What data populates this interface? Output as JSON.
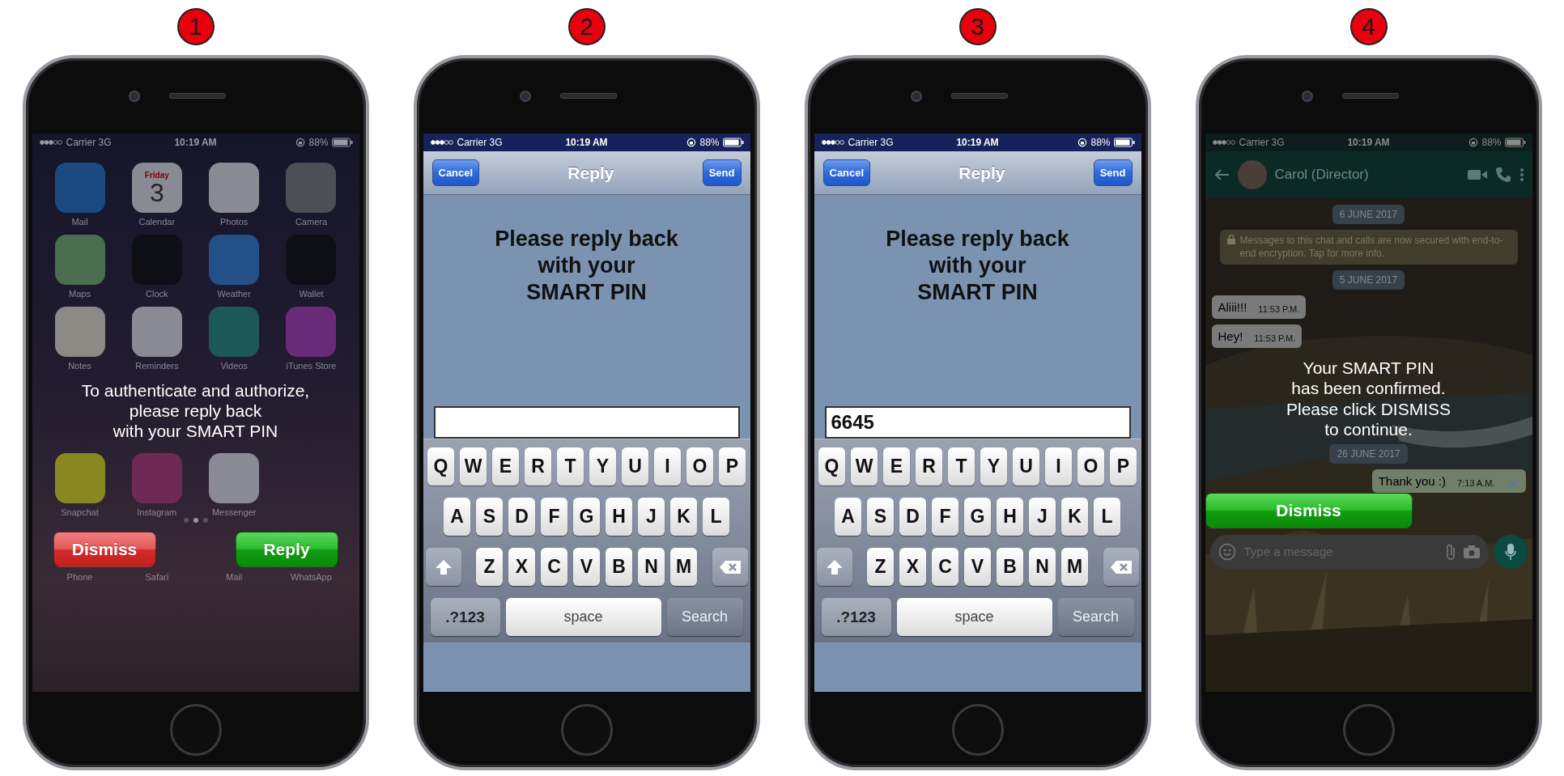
{
  "steps": [
    {
      "number": "1",
      "kind": "home_alert",
      "status_bar": {
        "carrier": "Carrier 3G",
        "time": "10:19 AM",
        "battery": "88%"
      },
      "apps": [
        {
          "label": "Mail",
          "color": "#1b4a80"
        },
        {
          "label": "Calendar",
          "color": "#8a8a94",
          "day": "Friday",
          "date": "3"
        },
        {
          "label": "Photos",
          "color": "#8a8a94"
        },
        {
          "label": "Camera",
          "color": "#4e4e56"
        },
        {
          "label": "Maps",
          "color": "#4a6e50"
        },
        {
          "label": "Clock",
          "color": "#0e0e16"
        },
        {
          "label": "Weather",
          "color": "#24508a"
        },
        {
          "label": "Wallet",
          "color": "#0e0e16"
        },
        {
          "label": "Notes",
          "color": "#8c8a84"
        },
        {
          "label": "Reminders",
          "color": "#8a8a94"
        },
        {
          "label": "Videos",
          "color": "#1d5858"
        },
        {
          "label": "iTunes Store",
          "color": "#6a2a7a"
        }
      ],
      "message": "To authenticate and authorize,\nplease reply back\nwith your SMART PIN",
      "more_apps": [
        {
          "label": "Snapchat",
          "color": "#8a8820"
        },
        {
          "label": "Instagram",
          "color": "#6e2a55"
        },
        {
          "label": "Messenger",
          "color": "#8a8a94"
        }
      ],
      "buttons": [
        {
          "label": "Dismiss",
          "kind": "danger"
        },
        {
          "label": "Reply",
          "kind": "confirm"
        }
      ],
      "dock": [
        {
          "label": "Phone"
        },
        {
          "label": "Safari"
        },
        {
          "label": "Mail"
        },
        {
          "label": "WhatsApp"
        }
      ]
    },
    {
      "number": "2",
      "kind": "reply_form",
      "status_bar": {
        "carrier": "Carrier 3G",
        "time": "10:19 AM",
        "battery": "88%"
      },
      "nav": {
        "cancel": "Cancel",
        "title": "Reply",
        "send": "Send"
      },
      "prompt": "Please reply back\nwith your\nSMART PIN",
      "keyboard": {
        "rows": [
          [
            "Q",
            "W",
            "E",
            "R",
            "T",
            "Y",
            "U",
            "I",
            "O",
            "P"
          ],
          [
            "A",
            "S",
            "D",
            "F",
            "G",
            "H",
            "J",
            "K",
            "L"
          ],
          [
            "Z",
            "X",
            "C",
            "V",
            "B",
            "N",
            "M"
          ]
        ],
        "mode_key": ".?123",
        "space_key": "space",
        "action_key": "Search"
      }
    },
    {
      "number": "3",
      "kind": "reply_form",
      "status_bar": {
        "carrier": "Carrier 3G",
        "time": "10:19 AM",
        "battery": "88%"
      },
      "nav": {
        "cancel": "Cancel",
        "title": "Reply",
        "send": "Send"
      },
      "prompt": "Please reply back\nwith your\nSMART PIN",
      "field": {
        "value": "6645"
      },
      "keyboard": {
        "rows": [
          [
            "Q",
            "W",
            "E",
            "R",
            "T",
            "Y",
            "U",
            "I",
            "O",
            "P"
          ],
          [
            "A",
            "S",
            "D",
            "F",
            "G",
            "H",
            "J",
            "K",
            "L"
          ],
          [
            "Z",
            "X",
            "C",
            "V",
            "B",
            "N",
            "M"
          ]
        ],
        "mode_key": ".?123",
        "space_key": "space",
        "action_key": "Search"
      }
    },
    {
      "number": "4",
      "kind": "chat_confirm",
      "status_bar": {
        "carrier": "Carrier 3G",
        "time": "10:19 AM",
        "battery": "88%"
      },
      "chat": {
        "contact": "Carol (Director)",
        "messages_top": [
          {
            "kind": "date",
            "text": "6 JUNE 2017"
          },
          {
            "kind": "notice",
            "text": "Messages to this chat and calls are now secured with end-to-end encryption. Tap for more info."
          },
          {
            "kind": "date",
            "text": "5 JUNE 2017"
          },
          {
            "kind": "incoming",
            "text": "Aliii!!!",
            "time": "11:53 P.M."
          },
          {
            "kind": "incoming",
            "text": "Hey!",
            "time": "11:53 P.M."
          }
        ],
        "messages_bottom": [
          {
            "kind": "date",
            "text": "26 JUNE 2017"
          },
          {
            "kind": "outgoing",
            "text": "Thank you :)",
            "time": "7:13 A.M."
          }
        ],
        "composer": {
          "placeholder": "Type a message"
        }
      },
      "message": "Your SMART PIN\nhas been confirmed.\nPlease click DISMISS\nto continue.",
      "button": {
        "label": "Dismiss"
      }
    }
  ]
}
